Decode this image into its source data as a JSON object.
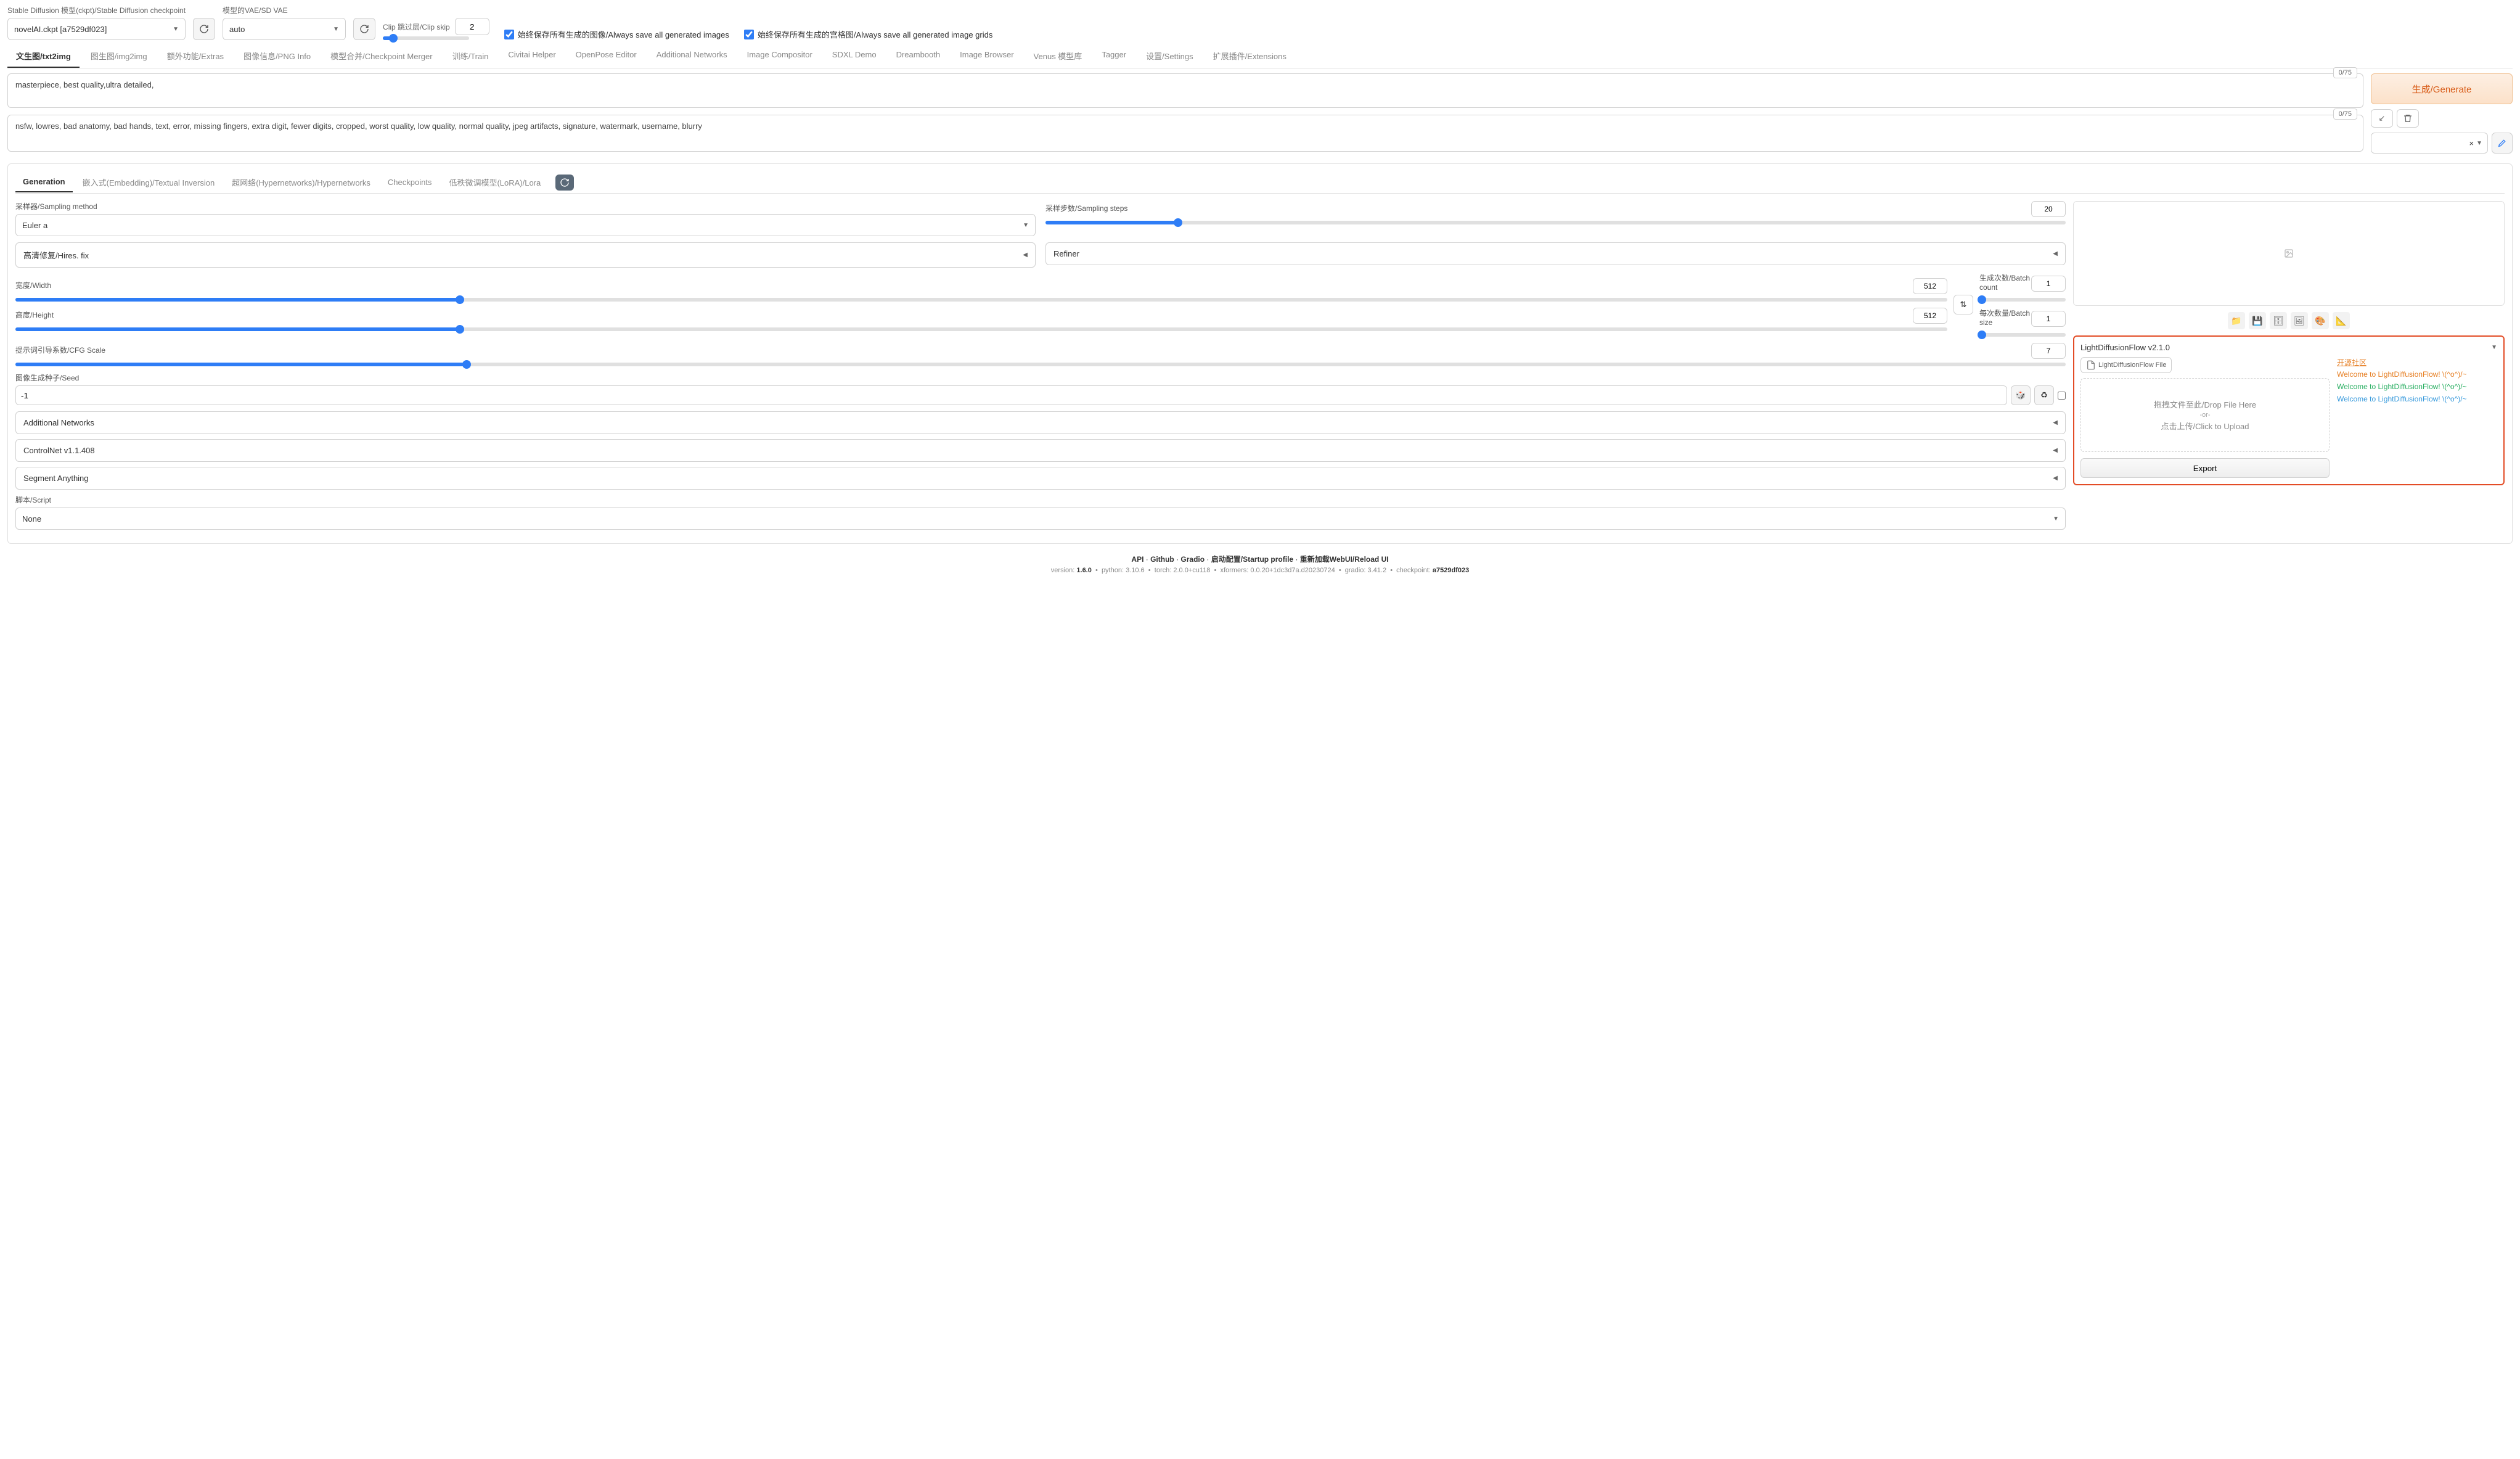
{
  "header": {
    "ckpt_label": "Stable Diffusion 模型(ckpt)/Stable Diffusion checkpoint",
    "ckpt_value": "novelAI.ckpt [a7529df023]",
    "vae_label": "模型的VAE/SD VAE",
    "vae_value": "auto",
    "clip_label": "Clip 跳过层/Clip skip",
    "clip_value": "2",
    "save_images": "始终保存所有生成的图像/Always save all generated images",
    "save_grids": "始终保存所有生成的宫格图/Always save all generated image grids"
  },
  "tabs": [
    "文生图/txt2img",
    "图生图/img2img",
    "额外功能/Extras",
    "图像信息/PNG Info",
    "模型合并/Checkpoint Merger",
    "训练/Train",
    "Civitai Helper",
    "OpenPose Editor",
    "Additional Networks",
    "Image Compositor",
    "SDXL Demo",
    "Dreambooth",
    "Image Browser",
    "Venus 模型库",
    "Tagger",
    "设置/Settings",
    "扩展插件/Extensions"
  ],
  "prompt": {
    "positive": "masterpiece, best quality,ultra detailed,",
    "negative": "nsfw, lowres, bad anatomy, bad hands, text, error, missing fingers, extra digit, fewer digits, cropped, worst quality, low quality, normal quality, jpeg artifacts, signature, watermark, username, blurry",
    "counter_pos": "0/75",
    "counter_neg": "0/75"
  },
  "generate": "生成/Generate",
  "style_x": "×",
  "sub_tabs": [
    "Generation",
    "嵌入式(Embedding)/Textual Inversion",
    "超网络(Hypernetworks)/Hypernetworks",
    "Checkpoints",
    "低秩微调模型(LoRA)/Lora"
  ],
  "gen": {
    "sampler_label": "采样器/Sampling method",
    "sampler_value": "Euler a",
    "steps_label": "采样步数/Sampling steps",
    "steps_value": "20",
    "hires": "高清修复/Hires. fix",
    "refiner": "Refiner",
    "width_label": "宽度/Width",
    "width_value": "512",
    "height_label": "高度/Height",
    "height_value": "512",
    "batch_count_label": "生成次数/Batch count",
    "batch_count_value": "1",
    "batch_size_label": "每次数量/Batch size",
    "batch_size_value": "1",
    "cfg_label": "提示词引导系数/CFG Scale",
    "cfg_value": "7",
    "seed_label": "图像生成种子/Seed",
    "seed_value": "-1",
    "addnet": "Additional Networks",
    "controlnet": "ControlNet v1.1.408",
    "segment": "Segment Anything",
    "script_label": "脚本/Script",
    "script_value": "None"
  },
  "ldf": {
    "title": "LightDiffusionFlow v2.1.0",
    "file_label": "LightDiffusionFlow File",
    "drop1": "拖拽文件至此/Drop File Here",
    "drop2": "-or-",
    "drop3": "点击上传/Click to Upload",
    "export": "Export",
    "community": "开源社区",
    "msg1": "Welcome to LightDiffusionFlow! \\(^o^)/~",
    "msg2": "Welcome to LightDiffusionFlow! \\(^o^)/~",
    "msg3": "Welcome to LightDiffusionFlow! \\(^o^)/~"
  },
  "footer": {
    "links": [
      "API",
      "Github",
      "Gradio",
      "启动配置/Startup profile",
      "重新加载WebUI/Reload UI"
    ],
    "version_lbl": "version:",
    "version": "1.6.0",
    "python_lbl": "python:",
    "python": "3.10.6",
    "torch_lbl": "torch:",
    "torch": "2.0.0+cu118",
    "xformers_lbl": "xformers:",
    "xformers": "0.0.20+1dc3d7a.d20230724",
    "gradio_lbl": "gradio:",
    "gradio": "3.41.2",
    "ckpt_lbl": "checkpoint:",
    "ckpt": "a7529df023"
  }
}
